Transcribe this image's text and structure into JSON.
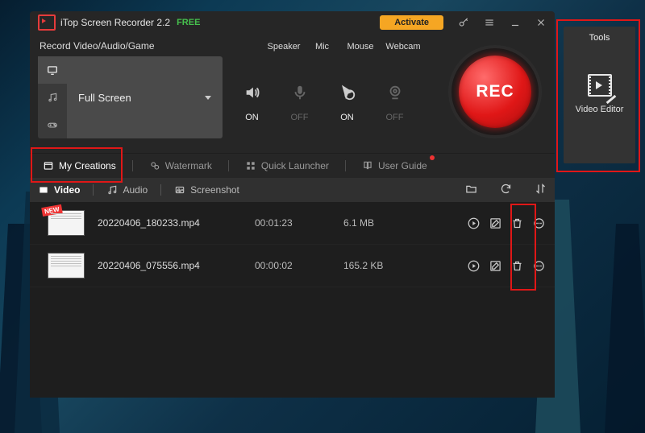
{
  "titlebar": {
    "app_name": "iTop Screen Recorder 2.2",
    "free_tag": "FREE",
    "activate_label": "Activate"
  },
  "record": {
    "heading": "Record Video/Audio/Game",
    "mode_label": "Full Screen",
    "devices": {
      "speaker": {
        "label": "Speaker",
        "state": "ON"
      },
      "mic": {
        "label": "Mic",
        "state": "OFF"
      },
      "mouse": {
        "label": "Mouse",
        "state": "ON"
      },
      "webcam": {
        "label": "Webcam",
        "state": "OFF"
      }
    },
    "rec_label": "REC"
  },
  "nav": {
    "my_creations": "My Creations",
    "watermark": "Watermark",
    "quick_launcher": "Quick Launcher",
    "user_guide": "User Guide"
  },
  "subtabs": {
    "video": "Video",
    "audio": "Audio",
    "screenshot": "Screenshot"
  },
  "files": [
    {
      "name": "20220406_180233.mp4",
      "duration": "00:01:23",
      "size": "6.1 MB",
      "is_new": true
    },
    {
      "name": "20220406_075556.mp4",
      "duration": "00:00:02",
      "size": "165.2 KB",
      "is_new": false
    }
  ],
  "tools": {
    "panel_title": "Tools",
    "video_editor": "Video Editor"
  }
}
